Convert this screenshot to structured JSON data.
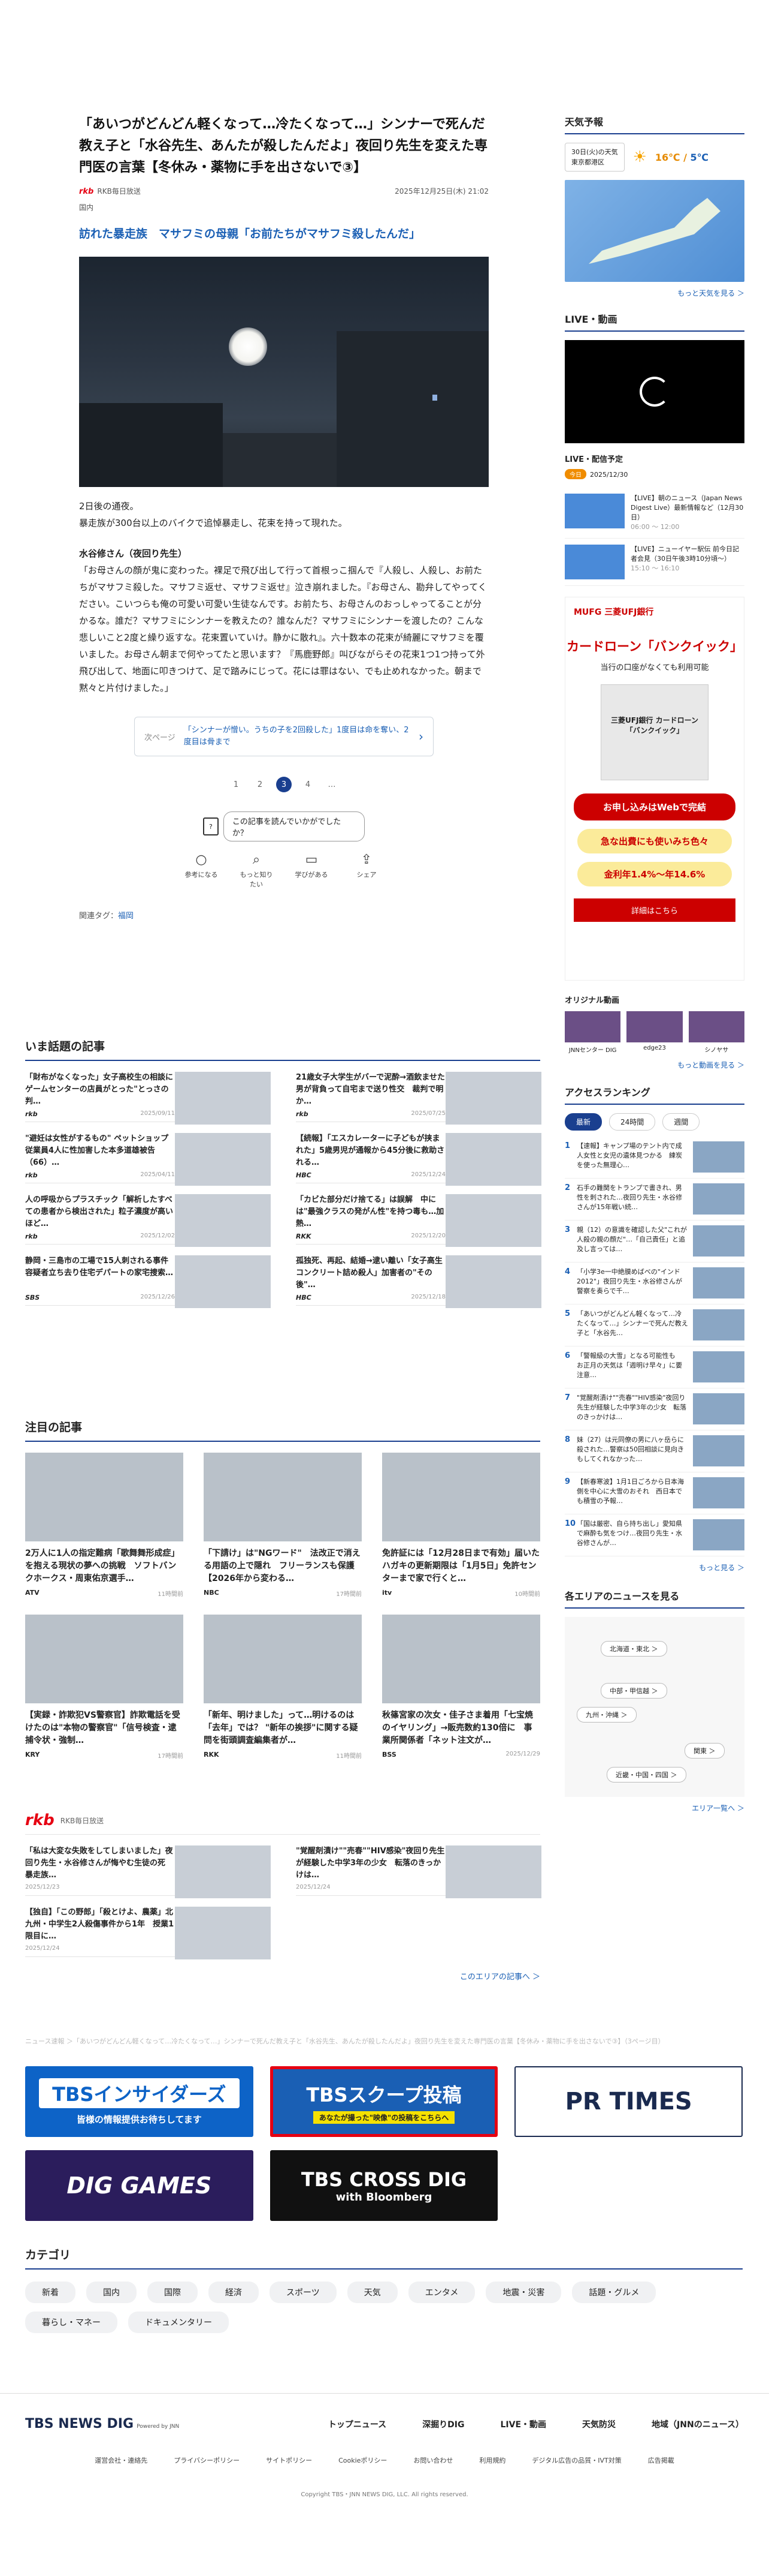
{
  "article": {
    "title": "「あいつがどんどん軽くなって…冷たくなって…」シンナーで死んだ教え子と「水谷先生、あんたが殺したんだよ」夜回り先生を変えた専門医の言葉【冬休み・薬物に手を出さないで③】",
    "source": "RKB毎日放送",
    "source_logo": "rkb",
    "date": "2025年12月25日(木) 21:02",
    "category": "国内",
    "related_link": "訪れた暴走族　マサフミの母親「お前たちがマサフミ殺したんだ」",
    "paras": [
      "2日後の通夜。\n暴走族が300台以上のバイクで追悼暴走し、花束を持って現れた。"
    ],
    "subhead": "水谷修さん（夜回り先生）",
    "quote": "「お母さんの顔が鬼に変わった。裸足で飛び出して行って首根っこ掴んで『人殺し、人殺し、お前たちがマサフミ殺した。マサフミ返せ、マサフミ返せ』泣き崩れました。『お母さん、勘弁してやってください。こいつらも俺の可愛い可愛い生徒なんです。お前たち、お母さんのおっしゃってることが分かるな。誰だ？マサフミにシンナーを教えたの？誰なんだ？マサフミにシンナーを渡したの？こんな悲しいこと2度と繰り返すな。花束置いていけ。静かに散れ』。六十数本の花束が綺麗にマサフミを覆いました。お母さん朝まで何やってたと思います？『馬鹿野郎』叫びながらその花束1つ1つ持って外飛び出して、地面に叩きつけて、足で踏みにじって。花には罪はない、でも止めれなかった。朝まで黙々と片付けました。」",
    "next_label": "次ページ",
    "next_text": "「シンナーが憎い。うちの子を2回殺した」1度目は命を奪い、2度目は骨まで",
    "pages": [
      "1",
      "2",
      "3",
      "4",
      "…"
    ],
    "helpful_icon": "?",
    "helpful_q": "この記事を読んでいかがでしたか？",
    "reactions": [
      "参考になる",
      "もっと知りたい",
      "学びがある",
      "シェア"
    ],
    "tags_label": "関連タグ：",
    "tag": "福岡"
  },
  "hot": {
    "heading": "いま話題の記事",
    "items": [
      {
        "title": "「財布がなくなった」女子高校生の相談にゲームセンターの店員がとった\"とっさの判…",
        "src": "rkb",
        "date": "2025/09/11"
      },
      {
        "title": "21歳女子大学生がバーで泥酔→酒飲ませた男が背負って自宅まで送り性交　裁判で明か…",
        "src": "rkb",
        "date": "2025/07/25"
      },
      {
        "title": "\"避妊は女性がするもの\" ペットショップ従業員4人に性加害した本多道雄被告（66）…",
        "src": "rkb",
        "date": "2025/04/11"
      },
      {
        "title": "【続報】「エスカレーターに子どもが挟まれた」5歳男児が通報から45分後に救助される…",
        "src": "HBC",
        "date": "2025/12/24"
      },
      {
        "title": "人の呼吸からプラスチック「解析したすべての患者から検出された」粒子濃度が高いほど…",
        "src": "rkb",
        "date": "2025/12/02"
      },
      {
        "title": "「カビた部分だけ捨てる」は誤解　中には\"最強クラスの発がん性\"を持つ毒も…加熱…",
        "src": "RKK",
        "date": "2025/12/20"
      },
      {
        "title": "静岡・三島市の工場で15人刺される事件　容疑者立ち去り住宅デパートの家宅捜索…",
        "src": "SBS",
        "date": "2025/12/26"
      },
      {
        "title": "孤独死、再起、結婚→逮い離い「女子高生コンクリート詰め殺人」加害者の\"その後\"…",
        "src": "HBC",
        "date": "2025/12/18"
      }
    ]
  },
  "featured": {
    "heading": "注目の記事",
    "items": [
      {
        "title": "2万人に1人の指定難病「歌舞舞形成症」を抱える現状の夢への挑戦　ソフトバンクホークス・周東佑京選手…",
        "src": "ATV",
        "date": "11時間前"
      },
      {
        "title": "「下請け」は\"NGワード\"　法改正で消える用語の上で隠れ　フリーランスも保護【2026年から変わる…",
        "src": "NBC",
        "date": "17時間前"
      },
      {
        "title": "免許証には「12月28日まで有効」届いたハガキの更新期限は「1月5日」免許センターまで家で行くと…",
        "src": "itv",
        "date": "10時間前"
      },
      {
        "title": "【実録・詐欺犯VS警察官】詐欺電話を受けたのは\"本物の警察官\"「信号検査・逮捕令状・強制…",
        "src": "KRY",
        "date": "17時間前"
      },
      {
        "title": "「新年、明けました」って…明けるのは「去年」では？ \"新年の挨拶\"に関する疑問を街頭調査編集者が…",
        "src": "RKK",
        "date": "11時間前"
      },
      {
        "title": "秋篠宮家の次女・佳子さま着用「七宝焼のイヤリング」→販売数約130倍に　事業所関係者「ネット注文が…",
        "src": "BSS",
        "date": "2025/12/29"
      }
    ]
  },
  "rkb": {
    "logo": "rkb",
    "label": "RKB毎日放送",
    "items": [
      {
        "title": "「私は大変な失敗をしてしまいました」夜回り先生・水谷修さんが悔やむ生徒の死　暴走族…",
        "date": "2025/12/23"
      },
      {
        "title": "\"覚醒剤漬け\"\"売春\"\"HIV感染\"夜回り先生が経験した中学3年の少女　転落のきっかけは…",
        "date": "2025/12/24"
      },
      {
        "title": "【独自】「この野郎」「殺とけよ、農薬」北九州・中学生2人殺傷事件から1年　授業1限目に…",
        "date": "2025/12/24"
      }
    ],
    "more": "このエリアの記事へ ＞"
  },
  "crumb": "ニュース速報 ＞「あいつがどんどん軽くなって…冷たくなって…」シンナーで死んだ教え子と「水谷先生、あんたが殺したんだよ」夜回り先生を変えた専門医の言葉【冬休み・薬物に手を出さないで③】（3ページ目）",
  "banners": [
    {
      "label": "TBSインサイダーズ",
      "sub": "皆様の情報提供お待ちしてます"
    },
    {
      "label": "TBSスクープ投稿",
      "sub": "あなたが撮った\"映像\"の投稿をこちらへ"
    },
    {
      "label": "PR TIMES",
      "sub": ""
    },
    {
      "label": "DIG GAMES",
      "sub": ""
    },
    {
      "label": "TBS CROSS DIG",
      "sub": "with Bloomberg"
    }
  ],
  "categories": {
    "heading": "カテゴリ",
    "items": [
      "新着",
      "国内",
      "国際",
      "経済",
      "スポーツ",
      "天気",
      "エンタメ",
      "地震・災害",
      "話題・グルメ",
      "暮らし・マネー",
      "ドキュメンタリー"
    ]
  },
  "footer": {
    "logo": "TBS NEWS DIG",
    "logo_sub": "Powered by JNN",
    "nav": [
      "トップニュース",
      "深掘りDIG",
      "LIVE・動画",
      "天気防災",
      "地域（JNNのニュース）"
    ],
    "links": [
      "運営会社・連絡先",
      "プライバシーポリシー",
      "サイトポリシー",
      "Cookieポリシー",
      "お問い合わせ",
      "利用規約",
      "デジタル広告の品質・IVT対策",
      "広告掲載"
    ],
    "copyright": "Copyright TBS・JNN NEWS DIG, LLC. All rights reserved."
  },
  "sidebar": {
    "weather": {
      "heading": "天気予報",
      "date": "30日(火)の天気",
      "loc": "東京都港区",
      "high": "16℃",
      "low": "5℃",
      "more": "もっと天気を見る ＞"
    },
    "live": {
      "heading": "LIVE・動画",
      "sched_heading": "LIVE・配信予定",
      "badge": "今日",
      "date": "2025/12/30",
      "items": [
        {
          "title": "【LIVE】朝のニュース（Japan News Digest Live）最新情報など（12月30日）",
          "time": "06:00 ～ 12:00"
        },
        {
          "title": "【LIVE】ニューイヤー駅伝 前今日記者会見（30日午後3時10分頃～）",
          "time": "15:10 ～ 16:10"
        }
      ]
    },
    "ad": {
      "brand": "MUFG 三菱UFJ銀行",
      "headline": "カードローン「バンクイック」",
      "sub": "当行の口座がなくても利用可能",
      "card": "三菱UFJ銀行 カードローン「バンクイック」",
      "cta": "お申し込みはWebで完結",
      "p1": "急な出費にも使いみち色々",
      "p2": "金利年1.4%〜年14.6%",
      "detail": "詳細はこちら"
    },
    "orig": {
      "heading": "オリジナル動画",
      "items": [
        "JNNセンター DIG",
        "edge23",
        "シノヤサ"
      ],
      "more": "もっと動画を見る ＞"
    },
    "ranking": {
      "heading": "アクセスランキング",
      "tabs": [
        "最新",
        "24時間",
        "週間"
      ],
      "items": [
        {
          "n": "1",
          "title": "【速報】キャンプ場のテント内で成人女性と女児の遺体見つかる　練炭を使った無理心…"
        },
        {
          "n": "2",
          "title": "石手の難関をトランプで書きれ、男性を刺された…夜回り先生・水谷修さんが15年戦い続…"
        },
        {
          "n": "3",
          "title": "親（12）の意識を確認した父\"これが人殺の親の顔だ\"…「自己責任」と追及し言っては…"
        },
        {
          "n": "4",
          "title": "「小学3e一中絶膜めばべの\"インド2012\"」夜回り先生・水谷修さんが警察を奏らで千…"
        },
        {
          "n": "5",
          "title": "「あいつがどんどん軽くなって…冷たくなって…」シンナーで死んだ教え子と「水谷先…"
        },
        {
          "n": "6",
          "title": "「警報級の大雪」となる可能性も　お正月の天気は「週明け早々」に要注意…"
        },
        {
          "n": "7",
          "title": "\"覚醒剤漬け\"\"売春\"\"HIV感染\"夜回り先生が経験した中学3年の少女　転落のきっかけは…"
        },
        {
          "n": "8",
          "title": "妹（27）は元同僚の男に八ヶ岳らに殺された…警察は50回相談に見向きもしてくれなかった…"
        },
        {
          "n": "9",
          "title": "【新春寒波】1月1日ごろから日本海側を中心に大雪のおそれ　西日本でも積雪の予報…"
        },
        {
          "n": "10",
          "title": "「国は厳密、自ら持ち出し」愛知県で麻酔も気をつけ…夜回り先生・水谷修さんが…"
        }
      ],
      "more": "もっと見る ＞"
    },
    "areas": {
      "heading": "各エリアのニュースを見る",
      "items": [
        "北海道・東北 ＞",
        "中部・甲信越 ＞",
        "九州・沖縄 ＞",
        "関東 ＞",
        "近畿・中国・四国 ＞"
      ],
      "more": "エリア一覧へ ＞"
    }
  }
}
